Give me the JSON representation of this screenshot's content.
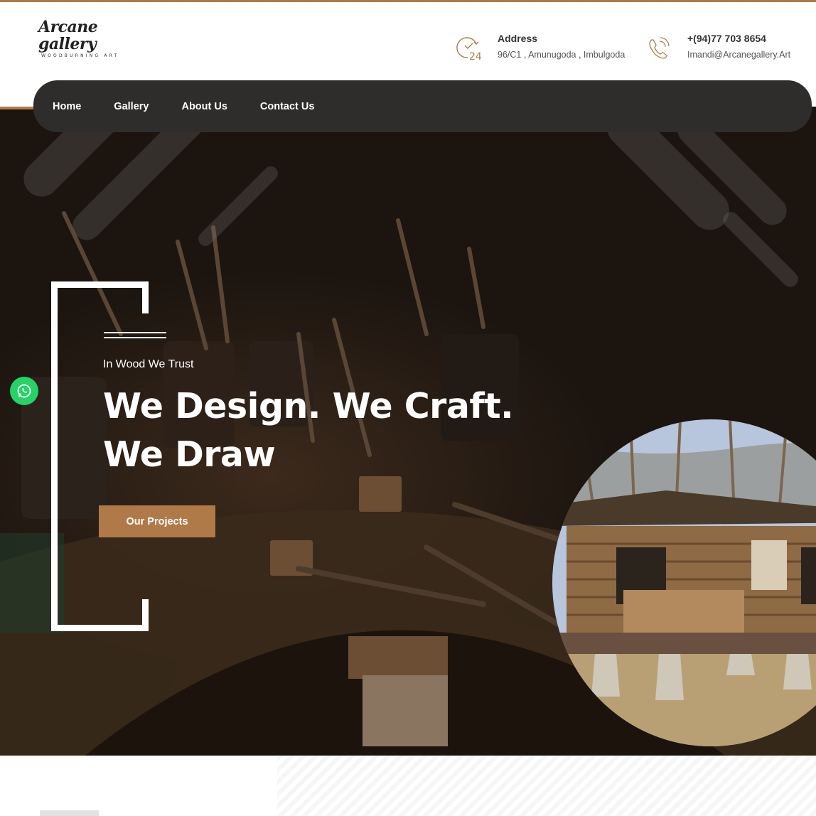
{
  "brand": {
    "logo_text": "Arcane gallery",
    "logo_tagline": "WOODBURNING ART"
  },
  "header": {
    "address": {
      "title": "Address",
      "value": "96/C1 , Amunugoda , Imbulgoda",
      "icon": "clock-24-icon"
    },
    "phone": {
      "title": "+(94)77 703 8654",
      "value": "Imandi@Arcanegallery.Art",
      "icon": "phone-icon"
    }
  },
  "nav": {
    "items": [
      "Home",
      "Gallery",
      "About Us",
      "Contact Us"
    ]
  },
  "hero": {
    "tagline": "In Wood We Trust",
    "headline_line1": "We Design. We Craft.",
    "headline_line2": "We Draw",
    "cta_label": "Our Projects"
  },
  "floating": {
    "whatsapp_icon": "whatsapp-icon"
  },
  "colors": {
    "accent": "#b07a48",
    "nav_bg": "#2f2d2b",
    "whatsapp": "#25d366"
  }
}
